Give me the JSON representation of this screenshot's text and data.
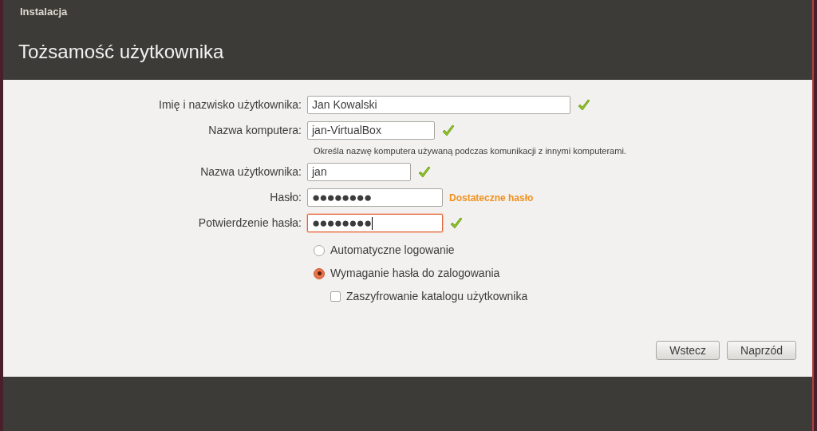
{
  "window": {
    "title": "Instalacja"
  },
  "header": {
    "title": "Tożsamość użytkownika"
  },
  "fields": [
    {
      "kind": "text",
      "label": "Imię i nazwisko użytkownika:",
      "value": "Jan Kowalski",
      "valid": true,
      "focused": false
    },
    {
      "kind": "text",
      "label": "Nazwa komputera:",
      "value": "jan-VirtualBox",
      "valid": true,
      "focused": false,
      "hint": "Określa nazwę komputera używaną podczas komunikacji z innymi komputerami."
    },
    {
      "kind": "text",
      "label": "Nazwa użytkownika:",
      "value": "jan",
      "valid": true,
      "focused": false
    },
    {
      "kind": "password",
      "label": "Hasło:",
      "value": "●●●●●●●●",
      "valid": false,
      "focused": false,
      "strength": "Dostateczne hasło"
    },
    {
      "kind": "password",
      "label": "Potwierdzenie hasła:",
      "value": "●●●●●●●●",
      "valid": true,
      "focused": true
    }
  ],
  "login_options": [
    {
      "label": "Automatyczne logowanie",
      "selected": false
    },
    {
      "label": "Wymaganie hasła do zalogowania",
      "selected": true
    }
  ],
  "encrypt_home": {
    "label": "Zaszyfrowanie katalogu użytkownika",
    "checked": false
  },
  "buttons": [
    {
      "label": "Wstecz"
    },
    {
      "label": "Naprzód"
    }
  ]
}
